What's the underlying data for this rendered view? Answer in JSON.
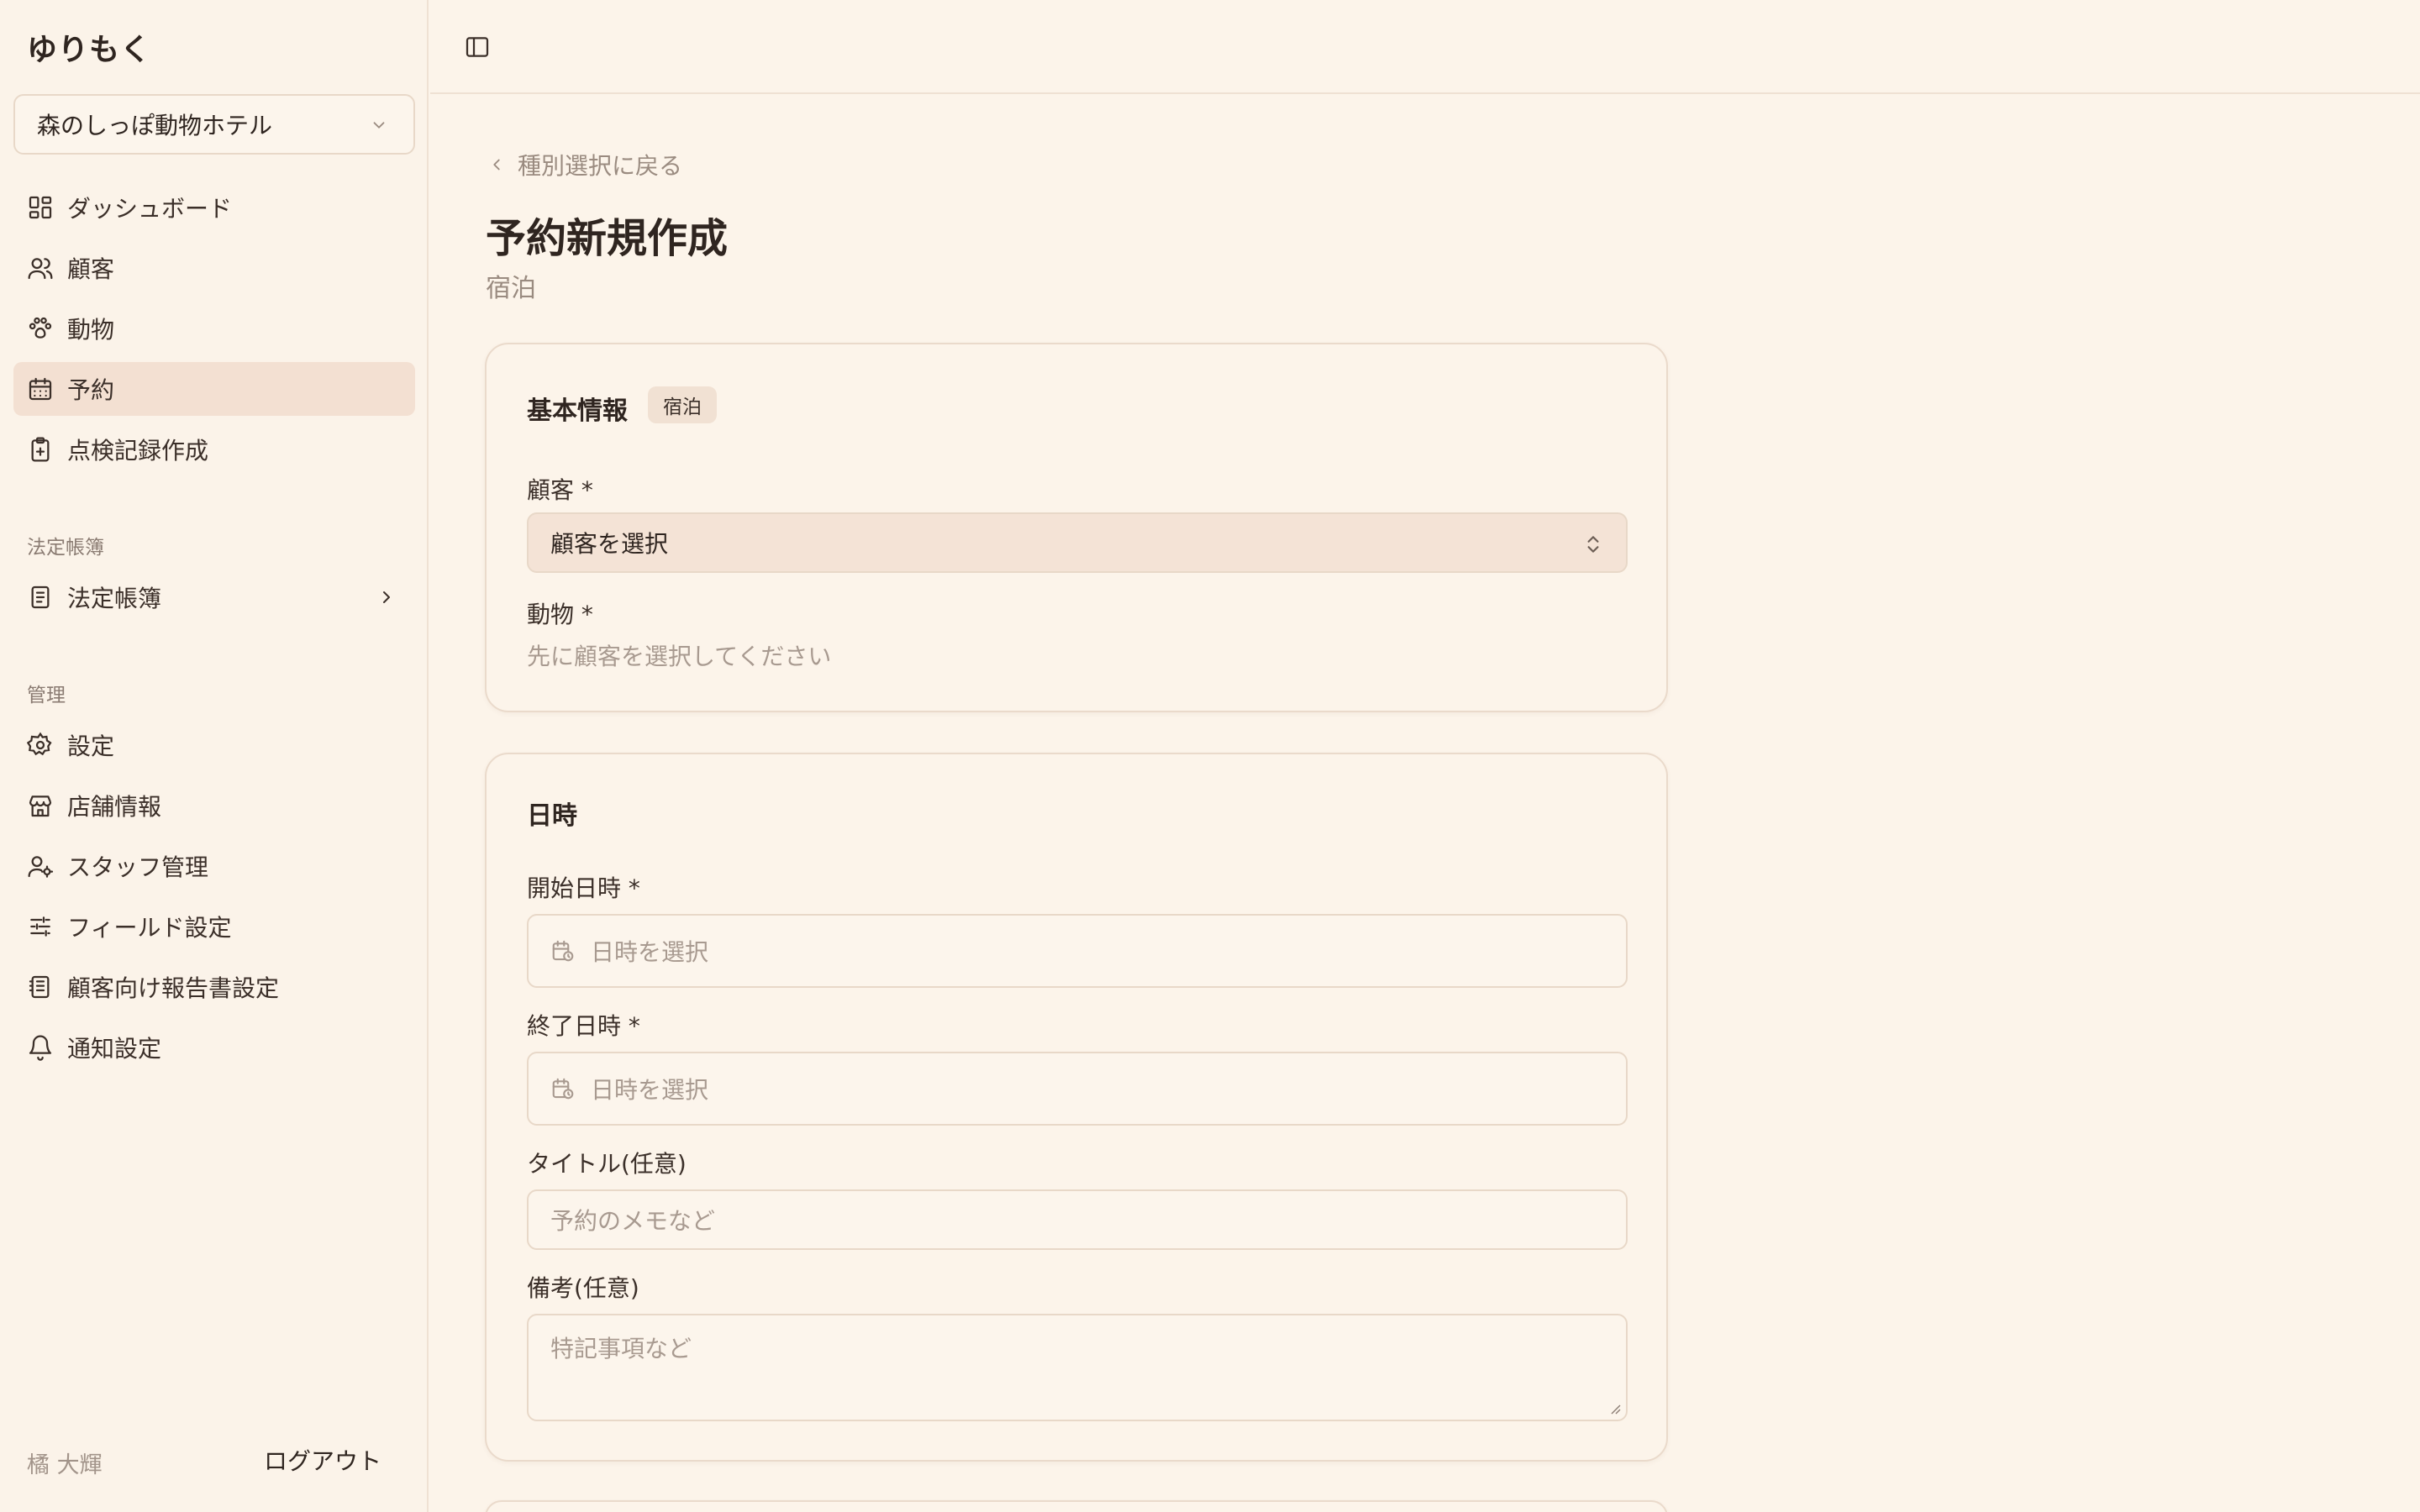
{
  "app": {
    "logo": "ゆりもく"
  },
  "sidebar": {
    "store_select": "森のしっぽ動物ホテル",
    "main_items": [
      {
        "label": "ダッシュボード",
        "icon": "dashboard-icon"
      },
      {
        "label": "顧客",
        "icon": "users-icon"
      },
      {
        "label": "動物",
        "icon": "paw-icon"
      },
      {
        "label": "予約",
        "icon": "calendar-icon",
        "active": true
      },
      {
        "label": "点検記録作成",
        "icon": "clipboard-plus-icon"
      }
    ],
    "legal_section": "法定帳簿",
    "legal_items": [
      {
        "label": "法定帳簿",
        "icon": "book-icon"
      }
    ],
    "admin_section": "管理",
    "admin_items": [
      {
        "label": "設定",
        "icon": "gear-icon"
      },
      {
        "label": "店舗情報",
        "icon": "store-icon"
      },
      {
        "label": "スタッフ管理",
        "icon": "user-cog-icon"
      },
      {
        "label": "フィールド設定",
        "icon": "sliders-icon"
      },
      {
        "label": "顧客向け報告書設定",
        "icon": "report-icon"
      },
      {
        "label": "通知設定",
        "icon": "bell-icon"
      }
    ],
    "user_name": "橘 大輝",
    "logout": "ログアウト"
  },
  "main": {
    "back_link": "種別選択に戻る",
    "title": "予約新規作成",
    "subtitle": "宿泊",
    "basic_card": {
      "title": "基本情報",
      "badge": "宿泊",
      "customer_label": "顧客 *",
      "customer_select": "顧客を選択",
      "animal_label": "動物 *",
      "animal_hint": "先に顧客を選択してください"
    },
    "datetime_card": {
      "title": "日時",
      "start_label": "開始日時 *",
      "start_placeholder": "日時を選択",
      "end_label": "終了日時 *",
      "end_placeholder": "日時を選択",
      "title_label": "タイトル(任意)",
      "title_placeholder": "予約のメモなど",
      "note_label": "備考(任意)",
      "note_placeholder": "特記事項など"
    }
  },
  "colors": {
    "background": "#fcf4ea",
    "active_nav": "#f3e0d2",
    "select_fill": "#f4e3d6",
    "border": "#eadacb"
  }
}
